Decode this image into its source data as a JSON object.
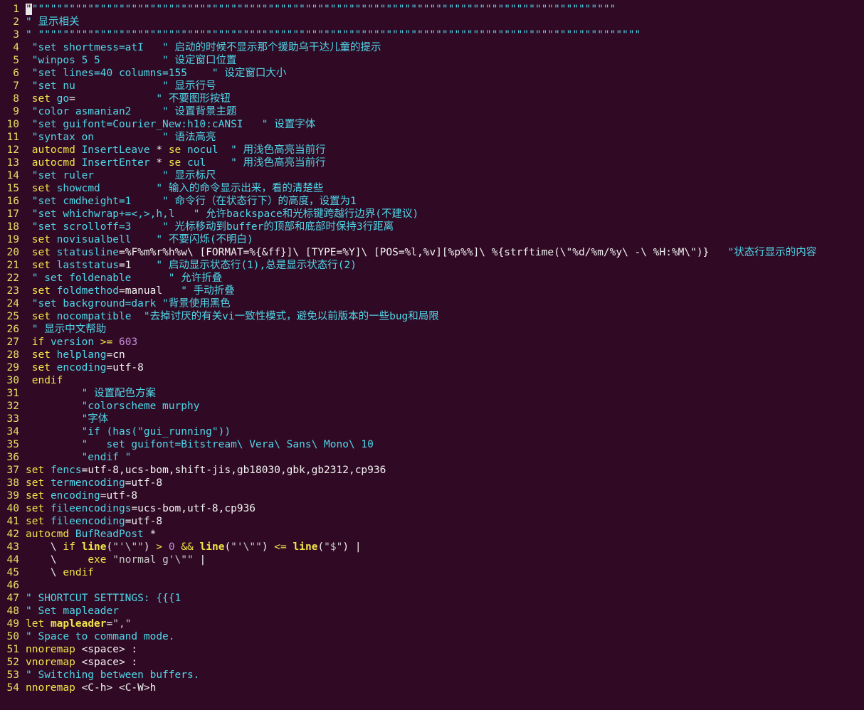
{
  "editor": {
    "background": "#300a24",
    "line_number_color": "#e8e060",
    "cursor_line": 1
  },
  "lines": [
    {
      "n": "1",
      "segs": [
        {
          "t": "\"",
          "c": "cursor"
        },
        {
          "t": "\"\"\"\"\"\"\"\"\"\"\"\"\"\"\"\"\"\"\"\"\"\"\"\"\"\"\"\"\"\"\"\"\"\"\"\"\"\"\"\"\"\"\"\"\"\"\"\"\"\"\"\"\"\"\"\"\"\"\"\"\"\"\"\"\"\"\"\"\"\"\"\"\"\"\"\"\"\"\"\"\"\"\"\"\"\"\"\"\"\"\"\"\"\"",
          "c": "c-comment"
        }
      ]
    },
    {
      "n": "2",
      "segs": [
        {
          "t": "\" 显示相关",
          "c": "c-comment"
        }
      ]
    },
    {
      "n": "3",
      "segs": [
        {
          "t": "\" \"\"\"\"\"\"\"\"\"\"\"\"\"\"\"\"\"\"\"\"\"\"\"\"\"\"\"\"\"\"\"\"\"\"\"\"\"\"\"\"\"\"\"\"\"\"\"\"\"\"\"\"\"\"\"\"\"\"\"\"\"\"\"\"\"\"\"\"\"\"\"\"\"\"\"\"\"\"\"\"\"\"\"\"\"\"\"\"\"\"\"\"\"\"\"\"\"",
          "c": "c-comment"
        }
      ]
    },
    {
      "n": "4",
      "segs": [
        {
          "t": " \"set shortmess=atI   \" 启动的时候不显示那个援助乌干达儿童的提示",
          "c": "c-comment"
        }
      ]
    },
    {
      "n": "5",
      "segs": [
        {
          "t": " \"winpos 5 5          \" 设定窗口位置",
          "c": "c-comment"
        }
      ]
    },
    {
      "n": "6",
      "segs": [
        {
          "t": " \"set lines=40 columns=155    \" 设定窗口大小",
          "c": "c-comment"
        }
      ]
    },
    {
      "n": "7",
      "segs": [
        {
          "t": " \"set nu              \" 显示行号",
          "c": "c-comment"
        }
      ]
    },
    {
      "n": "8",
      "segs": [
        {
          "t": " ",
          "c": "c-txt"
        },
        {
          "t": "set",
          "c": "c-kw"
        },
        {
          "t": " ",
          "c": "c-txt"
        },
        {
          "t": "go",
          "c": "c-opt"
        },
        {
          "t": "=             ",
          "c": "c-txt"
        },
        {
          "t": "\" 不要图形按钮",
          "c": "c-comment"
        }
      ]
    },
    {
      "n": "9",
      "segs": [
        {
          "t": " \"color asmanian2     \" 设置背景主题",
          "c": "c-comment"
        }
      ]
    },
    {
      "n": "10",
      "segs": [
        {
          "t": " \"set guifont=Courier_New:h10:cANSI   \" 设置字体",
          "c": "c-comment"
        }
      ]
    },
    {
      "n": "11",
      "segs": [
        {
          "t": " \"syntax on           \" 语法高亮",
          "c": "c-comment"
        }
      ]
    },
    {
      "n": "12",
      "segs": [
        {
          "t": " ",
          "c": "c-txt"
        },
        {
          "t": "autocmd",
          "c": "c-kw"
        },
        {
          "t": " ",
          "c": "c-txt"
        },
        {
          "t": "InsertLeave",
          "c": "c-opt"
        },
        {
          "t": " * ",
          "c": "c-txt"
        },
        {
          "t": "se",
          "c": "c-kw"
        },
        {
          "t": " ",
          "c": "c-txt"
        },
        {
          "t": "nocul",
          "c": "c-opt"
        },
        {
          "t": "  ",
          "c": "c-txt"
        },
        {
          "t": "\" 用浅色高亮当前行",
          "c": "c-comment"
        }
      ]
    },
    {
      "n": "13",
      "segs": [
        {
          "t": " ",
          "c": "c-txt"
        },
        {
          "t": "autocmd",
          "c": "c-kw"
        },
        {
          "t": " ",
          "c": "c-txt"
        },
        {
          "t": "InsertEnter",
          "c": "c-opt"
        },
        {
          "t": " * ",
          "c": "c-txt"
        },
        {
          "t": "se",
          "c": "c-kw"
        },
        {
          "t": " ",
          "c": "c-txt"
        },
        {
          "t": "cul",
          "c": "c-opt"
        },
        {
          "t": "    ",
          "c": "c-txt"
        },
        {
          "t": "\" 用浅色高亮当前行",
          "c": "c-comment"
        }
      ]
    },
    {
      "n": "14",
      "segs": [
        {
          "t": " \"set ruler           \" 显示标尺",
          "c": "c-comment"
        }
      ]
    },
    {
      "n": "15",
      "segs": [
        {
          "t": " ",
          "c": "c-txt"
        },
        {
          "t": "set",
          "c": "c-kw"
        },
        {
          "t": " ",
          "c": "c-txt"
        },
        {
          "t": "showcmd",
          "c": "c-opt"
        },
        {
          "t": "         ",
          "c": "c-txt"
        },
        {
          "t": "\" 输入的命令显示出来，看的清楚些",
          "c": "c-comment"
        }
      ]
    },
    {
      "n": "16",
      "segs": [
        {
          "t": " \"set cmdheight=1     \" 命令行（在状态行下）的高度，设置为1",
          "c": "c-comment"
        }
      ]
    },
    {
      "n": "17",
      "segs": [
        {
          "t": " \"set whichwrap+=<,>,h,l   \" 允许backspace和光标键跨越行边界(不建议)",
          "c": "c-comment"
        }
      ]
    },
    {
      "n": "18",
      "segs": [
        {
          "t": " \"set scrolloff=3     \" 光标移动到buffer的顶部和底部时保持3行距离",
          "c": "c-comment"
        }
      ]
    },
    {
      "n": "19",
      "segs": [
        {
          "t": " ",
          "c": "c-txt"
        },
        {
          "t": "set",
          "c": "c-kw"
        },
        {
          "t": " ",
          "c": "c-txt"
        },
        {
          "t": "novisualbell",
          "c": "c-opt"
        },
        {
          "t": "    ",
          "c": "c-txt"
        },
        {
          "t": "\" 不要闪烁(不明白)",
          "c": "c-comment"
        }
      ]
    },
    {
      "n": "20",
      "segs": [
        {
          "t": " ",
          "c": "c-txt"
        },
        {
          "t": "set",
          "c": "c-kw"
        },
        {
          "t": " ",
          "c": "c-txt"
        },
        {
          "t": "statusline",
          "c": "c-opt"
        },
        {
          "t": "=%F%m%r%h%w\\ [FORMAT=%{&ff}]\\ [TYPE=%Y]\\ [POS=%l,%v][%p%%]\\ %{strftime(\\\"%d/%m/%y\\ -\\ %H:%M\\\")}   ",
          "c": "c-txt"
        },
        {
          "t": "\"状态行显示的内容",
          "c": "c-comment"
        }
      ]
    },
    {
      "n": "21",
      "segs": [
        {
          "t": " ",
          "c": "c-txt"
        },
        {
          "t": "set",
          "c": "c-kw"
        },
        {
          "t": " ",
          "c": "c-txt"
        },
        {
          "t": "laststatus",
          "c": "c-opt"
        },
        {
          "t": "=1    ",
          "c": "c-txt"
        },
        {
          "t": "\" 启动显示状态行(1),总是显示状态行(2)",
          "c": "c-comment"
        }
      ]
    },
    {
      "n": "22",
      "segs": [
        {
          "t": " \" set foldenable      \" 允许折叠",
          "c": "c-comment"
        }
      ]
    },
    {
      "n": "23",
      "segs": [
        {
          "t": " ",
          "c": "c-txt"
        },
        {
          "t": "set",
          "c": "c-kw"
        },
        {
          "t": " ",
          "c": "c-txt"
        },
        {
          "t": "foldmethod",
          "c": "c-opt"
        },
        {
          "t": "=manual   ",
          "c": "c-txt"
        },
        {
          "t": "\" 手动折叠",
          "c": "c-comment"
        }
      ]
    },
    {
      "n": "24",
      "segs": [
        {
          "t": " \"set background=dark \"背景使用黑色",
          "c": "c-comment"
        }
      ]
    },
    {
      "n": "25",
      "segs": [
        {
          "t": " ",
          "c": "c-txt"
        },
        {
          "t": "set",
          "c": "c-kw"
        },
        {
          "t": " ",
          "c": "c-txt"
        },
        {
          "t": "nocompatible",
          "c": "c-opt"
        },
        {
          "t": "  ",
          "c": "c-txt"
        },
        {
          "t": "\"去掉讨厌的有关vi一致性模式，避免以前版本的一些bug和局限",
          "c": "c-comment"
        }
      ]
    },
    {
      "n": "26",
      "segs": [
        {
          "t": " \" 显示中文帮助",
          "c": "c-comment"
        }
      ]
    },
    {
      "n": "27",
      "segs": [
        {
          "t": " ",
          "c": "c-txt"
        },
        {
          "t": "if",
          "c": "c-kw"
        },
        {
          "t": " ",
          "c": "c-txt"
        },
        {
          "t": "version",
          "c": "c-opt"
        },
        {
          "t": " ",
          "c": "c-txt"
        },
        {
          "t": ">=",
          "c": "c-kw"
        },
        {
          "t": " ",
          "c": "c-txt"
        },
        {
          "t": "603",
          "c": "c-num"
        }
      ]
    },
    {
      "n": "28",
      "segs": [
        {
          "t": " ",
          "c": "c-txt"
        },
        {
          "t": "set",
          "c": "c-kw"
        },
        {
          "t": " ",
          "c": "c-txt"
        },
        {
          "t": "helplang",
          "c": "c-opt"
        },
        {
          "t": "=cn",
          "c": "c-txt"
        }
      ]
    },
    {
      "n": "29",
      "segs": [
        {
          "t": " ",
          "c": "c-txt"
        },
        {
          "t": "set",
          "c": "c-kw"
        },
        {
          "t": " ",
          "c": "c-txt"
        },
        {
          "t": "encoding",
          "c": "c-opt"
        },
        {
          "t": "=utf-8",
          "c": "c-txt"
        }
      ]
    },
    {
      "n": "30",
      "segs": [
        {
          "t": " ",
          "c": "c-txt"
        },
        {
          "t": "endif",
          "c": "c-kw"
        }
      ]
    },
    {
      "n": "31",
      "segs": [
        {
          "t": "         \" 设置配色方案",
          "c": "c-comment"
        }
      ]
    },
    {
      "n": "32",
      "segs": [
        {
          "t": "         \"colorscheme murphy",
          "c": "c-comment"
        }
      ]
    },
    {
      "n": "33",
      "segs": [
        {
          "t": "         \"字体",
          "c": "c-comment"
        }
      ]
    },
    {
      "n": "34",
      "segs": [
        {
          "t": "         \"if (has(\"gui_running\"))",
          "c": "c-comment"
        }
      ]
    },
    {
      "n": "35",
      "segs": [
        {
          "t": "         \"   set guifont=Bitstream\\ Vera\\ Sans\\ Mono\\ 10",
          "c": "c-comment"
        }
      ]
    },
    {
      "n": "36",
      "segs": [
        {
          "t": "         \"endif \"",
          "c": "c-comment"
        }
      ]
    },
    {
      "n": "37",
      "segs": [
        {
          "t": "set",
          "c": "c-kw"
        },
        {
          "t": " ",
          "c": "c-txt"
        },
        {
          "t": "fencs",
          "c": "c-opt"
        },
        {
          "t": "=utf-8,ucs-bom,shift-jis,gb18030,gbk,gb2312,cp936",
          "c": "c-txt"
        }
      ]
    },
    {
      "n": "38",
      "segs": [
        {
          "t": "set",
          "c": "c-kw"
        },
        {
          "t": " ",
          "c": "c-txt"
        },
        {
          "t": "termencoding",
          "c": "c-opt"
        },
        {
          "t": "=utf-8",
          "c": "c-txt"
        }
      ]
    },
    {
      "n": "39",
      "segs": [
        {
          "t": "set",
          "c": "c-kw"
        },
        {
          "t": " ",
          "c": "c-txt"
        },
        {
          "t": "encoding",
          "c": "c-opt"
        },
        {
          "t": "=utf-8",
          "c": "c-txt"
        }
      ]
    },
    {
      "n": "40",
      "segs": [
        {
          "t": "set",
          "c": "c-kw"
        },
        {
          "t": " ",
          "c": "c-txt"
        },
        {
          "t": "fileencodings",
          "c": "c-opt"
        },
        {
          "t": "=ucs-bom,utf-8,cp936",
          "c": "c-txt"
        }
      ]
    },
    {
      "n": "41",
      "segs": [
        {
          "t": "set",
          "c": "c-kw"
        },
        {
          "t": " ",
          "c": "c-txt"
        },
        {
          "t": "fileencoding",
          "c": "c-opt"
        },
        {
          "t": "=utf-8",
          "c": "c-txt"
        }
      ]
    },
    {
      "n": "42",
      "segs": [
        {
          "t": "autocmd",
          "c": "c-kw"
        },
        {
          "t": " ",
          "c": "c-txt"
        },
        {
          "t": "BufReadPost",
          "c": "c-opt"
        },
        {
          "t": " *",
          "c": "c-txt"
        }
      ]
    },
    {
      "n": "43",
      "segs": [
        {
          "t": "    \\ ",
          "c": "c-txt"
        },
        {
          "t": "if",
          "c": "c-kw"
        },
        {
          "t": " ",
          "c": "c-txt"
        },
        {
          "t": "line",
          "c": "c-fn"
        },
        {
          "t": "(",
          "c": "c-txt"
        },
        {
          "t": "\"'\\\"\"",
          "c": "c-str"
        },
        {
          "t": ") ",
          "c": "c-txt"
        },
        {
          "t": ">",
          "c": "c-kw"
        },
        {
          "t": " ",
          "c": "c-txt"
        },
        {
          "t": "0",
          "c": "c-num"
        },
        {
          "t": " ",
          "c": "c-txt"
        },
        {
          "t": "&&",
          "c": "c-kw"
        },
        {
          "t": " ",
          "c": "c-txt"
        },
        {
          "t": "line",
          "c": "c-fn"
        },
        {
          "t": "(",
          "c": "c-txt"
        },
        {
          "t": "\"'\\\"\"",
          "c": "c-str"
        },
        {
          "t": ") ",
          "c": "c-txt"
        },
        {
          "t": "<=",
          "c": "c-kw"
        },
        {
          "t": " ",
          "c": "c-txt"
        },
        {
          "t": "line",
          "c": "c-fn"
        },
        {
          "t": "(",
          "c": "c-txt"
        },
        {
          "t": "\"$\"",
          "c": "c-str"
        },
        {
          "t": ") |",
          "c": "c-txt"
        }
      ]
    },
    {
      "n": "44",
      "segs": [
        {
          "t": "    \\     ",
          "c": "c-txt"
        },
        {
          "t": "exe",
          "c": "c-kw"
        },
        {
          "t": " ",
          "c": "c-txt"
        },
        {
          "t": "\"normal g'\\\"\"",
          "c": "c-str"
        },
        {
          "t": " |",
          "c": "c-txt"
        }
      ]
    },
    {
      "n": "45",
      "segs": [
        {
          "t": "    \\ ",
          "c": "c-txt"
        },
        {
          "t": "endif",
          "c": "c-kw"
        }
      ]
    },
    {
      "n": "46",
      "segs": []
    },
    {
      "n": "47",
      "segs": [
        {
          "t": "\" SHORTCUT SETTINGS: {{{1",
          "c": "c-comment"
        }
      ]
    },
    {
      "n": "48",
      "segs": [
        {
          "t": "\" Set mapleader",
          "c": "c-comment"
        }
      ]
    },
    {
      "n": "49",
      "segs": [
        {
          "t": "let",
          "c": "c-kw"
        },
        {
          "t": " ",
          "c": "c-txt"
        },
        {
          "t": "mapleader",
          "c": "c-bold"
        },
        {
          "t": "=",
          "c": "c-txt"
        },
        {
          "t": "\",\"",
          "c": "c-str"
        }
      ]
    },
    {
      "n": "50",
      "segs": [
        {
          "t": "\" Space to command mode.",
          "c": "c-comment"
        }
      ]
    },
    {
      "n": "51",
      "segs": [
        {
          "t": "nnoremap",
          "c": "c-kw"
        },
        {
          "t": " ",
          "c": "c-txt"
        },
        {
          "t": "<space>",
          "c": "c-txt"
        },
        {
          "t": " :",
          "c": "c-txt"
        }
      ]
    },
    {
      "n": "52",
      "segs": [
        {
          "t": "vnoremap",
          "c": "c-kw"
        },
        {
          "t": " ",
          "c": "c-txt"
        },
        {
          "t": "<space>",
          "c": "c-txt"
        },
        {
          "t": " :",
          "c": "c-txt"
        }
      ]
    },
    {
      "n": "53",
      "segs": [
        {
          "t": "\" Switching between buffers.",
          "c": "c-comment"
        }
      ]
    },
    {
      "n": "54",
      "segs": [
        {
          "t": "nnoremap",
          "c": "c-kw"
        },
        {
          "t": " ",
          "c": "c-txt"
        },
        {
          "t": "<C-h>",
          "c": "c-txt"
        },
        {
          "t": " ",
          "c": "c-txt"
        },
        {
          "t": "<C-W>h",
          "c": "c-txt"
        }
      ]
    }
  ]
}
